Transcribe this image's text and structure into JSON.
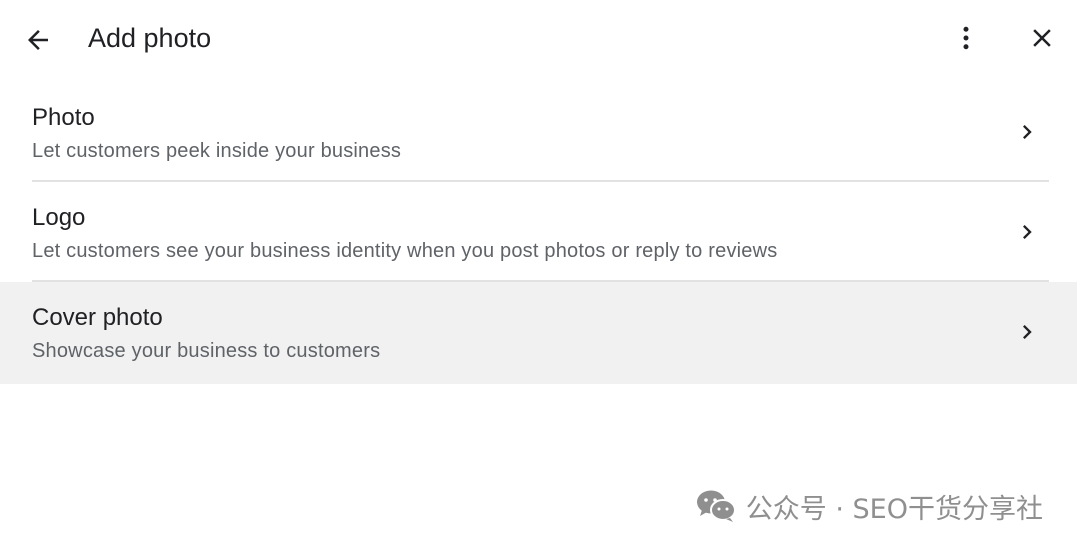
{
  "header": {
    "title": "Add photo",
    "back_icon": "arrow-left-icon",
    "more_icon": "more-vert-icon",
    "close_icon": "close-icon"
  },
  "items": [
    {
      "label": "Photo",
      "description": "Let customers peek inside your business",
      "highlighted": false
    },
    {
      "label": "Logo",
      "description": "Let customers see your business identity when you post photos or reply to reviews",
      "highlighted": false
    },
    {
      "label": "Cover photo",
      "description": "Showcase your business to customers",
      "highlighted": true
    }
  ],
  "watermark": {
    "icon": "wechat-icon",
    "text": "公众号 · SEO干货分享社"
  },
  "colors": {
    "text_primary": "#202124",
    "text_secondary": "#5f6368",
    "highlight_bg": "#f1f1f1",
    "divider": "#e2e2e2",
    "watermark": "#8f8f8f"
  }
}
